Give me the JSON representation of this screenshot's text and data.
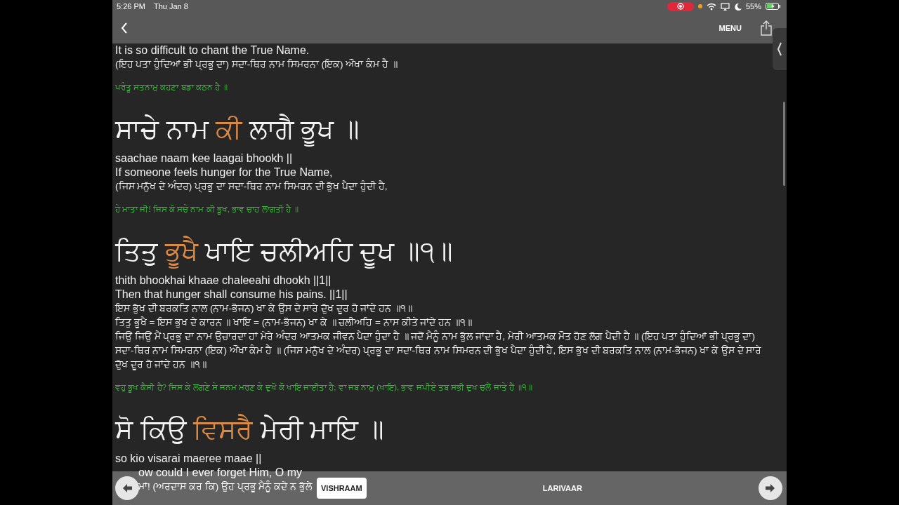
{
  "status_bar": {
    "time": "5:26 PM",
    "date": "Thu Jan 8",
    "battery": "55%"
  },
  "header": {
    "menu": "MENU"
  },
  "content": [
    {
      "kind": "english",
      "text": "It is so difficult to chant the True Name."
    },
    {
      "kind": "gurmukhi",
      "text": "(ਇਹ ਪਤਾ ਹੁੰਦਿਆਂ ਭੀ ਪ੍ਰਭੂ ਦਾ) ਸਦਾ-ਥਿਰ ਨਾਮ ਸਿਮਰਨਾ (ਇਕ) ਔਖਾ ਕੰਮ ਹੈ ॥"
    },
    {
      "kind": "commentary",
      "text": "ਪਰੰਤੂ ਸਤਨਾਮੁ ਕਹਣਾ ਬਡਾ ਕਠਨ ਹੈ ॥"
    },
    {
      "kind": "verse",
      "segments": [
        {
          "text": "ਸਾਚੇ ਨਾਮ",
          "highlight": false
        },
        {
          "text": "ਕੀ",
          "highlight": true
        },
        {
          "text": "ਲਾਗੈ ਭੂਖ ॥",
          "highlight": false
        }
      ]
    },
    {
      "kind": "english",
      "text": "saachae naam kee laagai bhookh ||"
    },
    {
      "kind": "english",
      "text": "If someone feels hunger for the True Name,"
    },
    {
      "kind": "gurmukhi",
      "text": "(ਜਿਸ ਮਨੁੱਖ ਦੇ ਅੰਦਰ) ਪ੍ਰਭੂ ਦਾ ਸਦਾ-ਥਿਰ ਨਾਮ ਸਿਮਰਨ ਦੀ ਭੁੱਖ ਪੈਦਾ ਹੁੰਦੀ ਹੈ,"
    },
    {
      "kind": "commentary",
      "text": "ਹੇ ਮਾਤਾ ਜੀ! ਜਿਸ ਕੋ ਸਚੇ ਨਾਮ ਕੀ ਭੂਖ, ਭਾਵ ਚਾਹ ਲਾਗਤੀ ਹੈ ॥"
    },
    {
      "kind": "verse",
      "segments": [
        {
          "text": "ਤਿਤੁ",
          "highlight": false
        },
        {
          "text": "ਭੂਖੈ",
          "highlight": true
        },
        {
          "text": "ਖਾਇ ਚਲੀਅਹਿ ਦੂਖ ॥੧॥",
          "highlight": false
        }
      ]
    },
    {
      "kind": "english",
      "text": "thith bhookhai khaae chaleeahi dhookh ||1||"
    },
    {
      "kind": "english",
      "text": "Then that hunger shall consume his pains. ||1||"
    },
    {
      "kind": "gurmukhi",
      "text": "ਇਸ ਭੁੱਖ ਦੀ ਬਰਕਤਿ ਨਾਲ (ਨਾਮ-ਭੋਜਨ) ਖਾ ਕੇ ਉਸ ਦੇ ਸਾਰੇ ਦੁੱਖ ਦੂਰ ਹੋ ਜਾਂਦੇ ਹਨ ॥੧॥"
    },
    {
      "kind": "gurmukhi",
      "text": "ਤਿਤੁ ਭੂਖੈ = ਇਸ ਭੁਖ ਦੇ ਕਾਰਨ ॥ ਖਾਇ = (ਨਾਮ-ਭੋਜਨ) ਖਾ ਕੇ ॥ ਚਲੀਅਹਿ = ਨਾਸ ਕੀਤੇ ਜਾਂਦੇ ਹਨ ॥੧॥"
    },
    {
      "kind": "gurmukhi",
      "text": "ਜਿਉਂ ਜਿਉਂ ਮੈਂ ਪ੍ਰਭੂ ਦਾ ਨਾਮ ਉਚਾਰਦਾ ਹਾਂ ਮੇਰੇ ਅੰਦਰ ਆਤਮਕ ਜੀਵਨ ਪੈਦਾ ਹੁੰਦਾ ਹੈ ॥ ਜਦੋਂ ਮੈਨੂੰ ਨਾਮ ਭੁੱਲ ਜਾਂਦਾ ਹੈ, ਮੇਰੀ ਆਤਮਕ ਮੌਤ ਹੋਣ ਲੱਗ ਪੈਂਦੀ ਹੈ ॥ (ਇਹ ਪਤਾ ਹੁੰਦਿਆਂ ਭੀ ਪ੍ਰਭੂ ਦਾ) ਸਦਾ-ਥਿਰ ਨਾਮ ਸਿਮਰਨਾ (ਇਕ) ਔਖਾ ਕੰਮ ਹੈ ॥ (ਜਿਸ ਮਨੁੱਖ ਦੇ ਅੰਦਰ) ਪ੍ਰਭੂ ਦਾ ਸਦਾ-ਥਿਰ ਨਾਮ ਸਿਮਰਨ ਦੀ ਭੁੱਖ ਪੈਦਾ ਹੁੰਦੀ ਹੈ, ਇਸ ਭੁੱਖ ਦੀ ਬਰਕਤਿ ਨਾਲ (ਨਾਮ-ਭੋਜਨ) ਖਾ ਕੇ ਉਸ ਦੇ ਸਾਰੇ ਦੁੱਖ ਦੂਰ ਹੋ ਜਾਂਦੇ ਹਨ ॥੧॥"
    },
    {
      "kind": "commentary",
      "text": "ਵਹੁ ਭੂਖ ਕੈਸੀ ਹੈ? ਜਿਸ ਕੇ ਲਗਣੇ ਸੇ ਜਨਮ ਮਰਣ ਕੇ ਦੁਖੋਂ ਕੋ ਖਾਇ ਜਾਈਤਾ ਹੈ; ਵਾ ਜਬ ਨਾਮੁ (ਖਾਇ), ਭਾਵ ਜਪੀਏ ਤਬ ਸਭੀ ਦੁਖ ਚਲੇ ਜਾਤੇ ਹੈਂ ॥੧॥"
    },
    {
      "kind": "verse",
      "segments": [
        {
          "text": "ਸੋ ਕਿਉ",
          "highlight": false
        },
        {
          "text": "ਵਿਸਰੈ",
          "highlight": true
        },
        {
          "text": "ਮੇਰੀ ਮਾਇ ॥",
          "highlight": false
        }
      ]
    },
    {
      "kind": "english",
      "text": "so kio visarai maeree maae ||"
    },
    {
      "kind": "english",
      "text": "ow could I ever forget Him, O my",
      "covered_start": true
    },
    {
      "kind": "gurmukhi",
      "text": "ਮਾਂ! (ਅਰਦਾਸ ਕਰ ਕਿ) ਉਹ ਪ੍ਰਭੂ ਮੈਨੂੰ ਕਦੇ ਨ ਭੁੱਲੇ",
      "covered_start": true
    }
  ],
  "bottom_bar": {
    "toggles": [
      {
        "label": "VISHRAAM",
        "selected": true
      },
      {
        "label": "LARIVAAR",
        "selected": false
      }
    ]
  }
}
